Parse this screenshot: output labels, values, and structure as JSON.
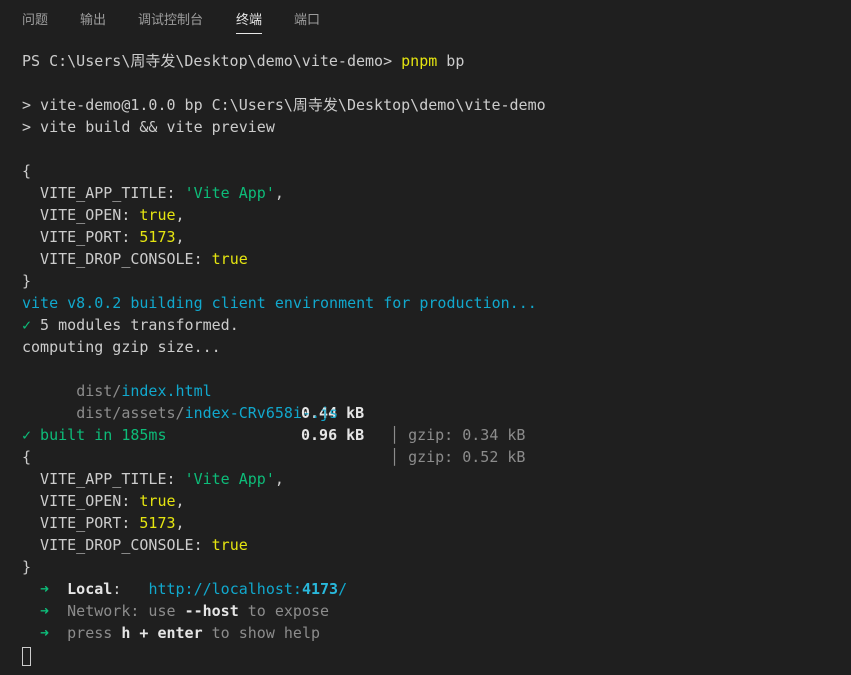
{
  "tabs": [
    {
      "label": "问题",
      "active": false
    },
    {
      "label": "输出",
      "active": false
    },
    {
      "label": "调试控制台",
      "active": false
    },
    {
      "label": "终端",
      "active": true
    },
    {
      "label": "端口",
      "active": false
    }
  ],
  "terminal": {
    "prompt": {
      "path": "PS C:\\Users\\周寺发\\Desktop\\demo\\vite-demo> ",
      "cmd": "pnpm",
      "args": " bp"
    },
    "script_line1": "> vite-demo@1.0.0 bp C:\\Users\\周寺发\\Desktop\\demo\\vite-demo",
    "script_line2": "> vite build && vite preview",
    "env1": {
      "open": "{",
      "title_key": "  VITE_APP_TITLE: ",
      "title_val": "'Vite App'",
      "title_comma": ",",
      "open_key": "  VITE_OPEN: ",
      "open_val": "true",
      "open_comma": ",",
      "port_key": "  VITE_PORT: ",
      "port_val": "5173",
      "port_comma": ",",
      "drop_key": "  VITE_DROP_CONSOLE: ",
      "drop_val": "true",
      "close": "}"
    },
    "building": "vite v8.0.2 building client environment for production...",
    "check": "✓",
    "transformed": " 5 modules transformed.",
    "computing": "computing gzip size...",
    "files": [
      {
        "dir": "dist/",
        "name": "index.html",
        "size": "0.44 kB",
        "sep": "│",
        "gzip_label": "gzip: ",
        "gzip": "0.34 kB"
      },
      {
        "dir": "dist/assets/",
        "name": "index-CRv658i-.js",
        "size": "0.96 kB",
        "sep": "│",
        "gzip_label": "gzip: ",
        "gzip": "0.52 kB"
      }
    ],
    "built": " built in 185ms",
    "env2": {
      "open": "{",
      "title_key": "  VITE_APP_TITLE: ",
      "title_val": "'Vite App'",
      "title_comma": ",",
      "open_key": "  VITE_OPEN: ",
      "open_val": "true",
      "open_comma": ",",
      "port_key": "  VITE_PORT: ",
      "port_val": "5173",
      "port_comma": ",",
      "drop_key": "  VITE_DROP_CONSOLE: ",
      "drop_val": "true",
      "close": "}"
    },
    "arrow": "  ➜  ",
    "local_label": "Local",
    "local_colon": ":   ",
    "local_url_prefix": "http://localhost:",
    "local_port": "4173",
    "local_url_suffix": "/",
    "network_label": "Network",
    "network_colon": ": use ",
    "network_flag": "--host",
    "network_rest": " to expose",
    "help_press": "press ",
    "help_h": "h",
    "help_plus": " + ",
    "help_enter": "enter",
    "help_rest": " to show help"
  }
}
